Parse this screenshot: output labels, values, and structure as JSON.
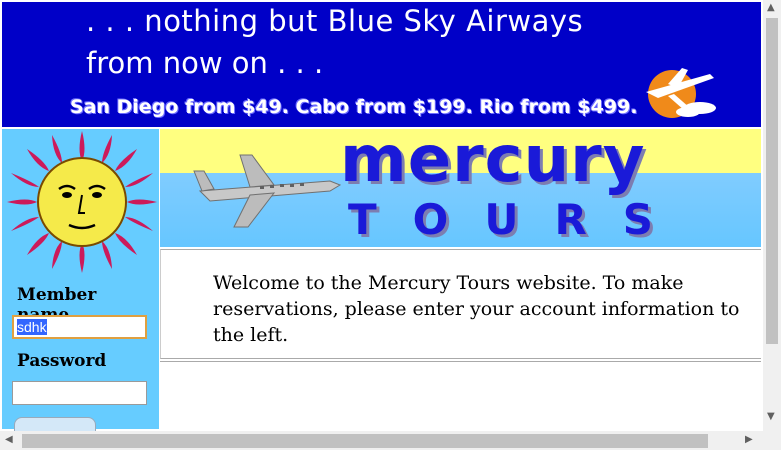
{
  "banner": {
    "line1": ". . . nothing but Blue Sky Airways",
    "line2": "from now on . . .",
    "fares": "San Diego from $49. Cabo from $199. Rio from $499."
  },
  "header": {
    "brand_top": "mercury",
    "brand_bottom": "TOURS"
  },
  "login": {
    "member_name_label": "Member name",
    "member_name_value": "sdhk",
    "password_label": "Password",
    "password_value": ""
  },
  "welcome": {
    "text": "Welcome to the Mercury Tours website. To make reservations, please enter your account information to the left."
  },
  "scrollbars": {
    "up_arrow": "▲",
    "down_arrow": "▼",
    "left_arrow": "◀",
    "right_arrow": "▶"
  },
  "colors": {
    "banner_bg": "#0000c8",
    "sidebar_bg": "#66ccff",
    "brand": "#1a1ad8"
  }
}
